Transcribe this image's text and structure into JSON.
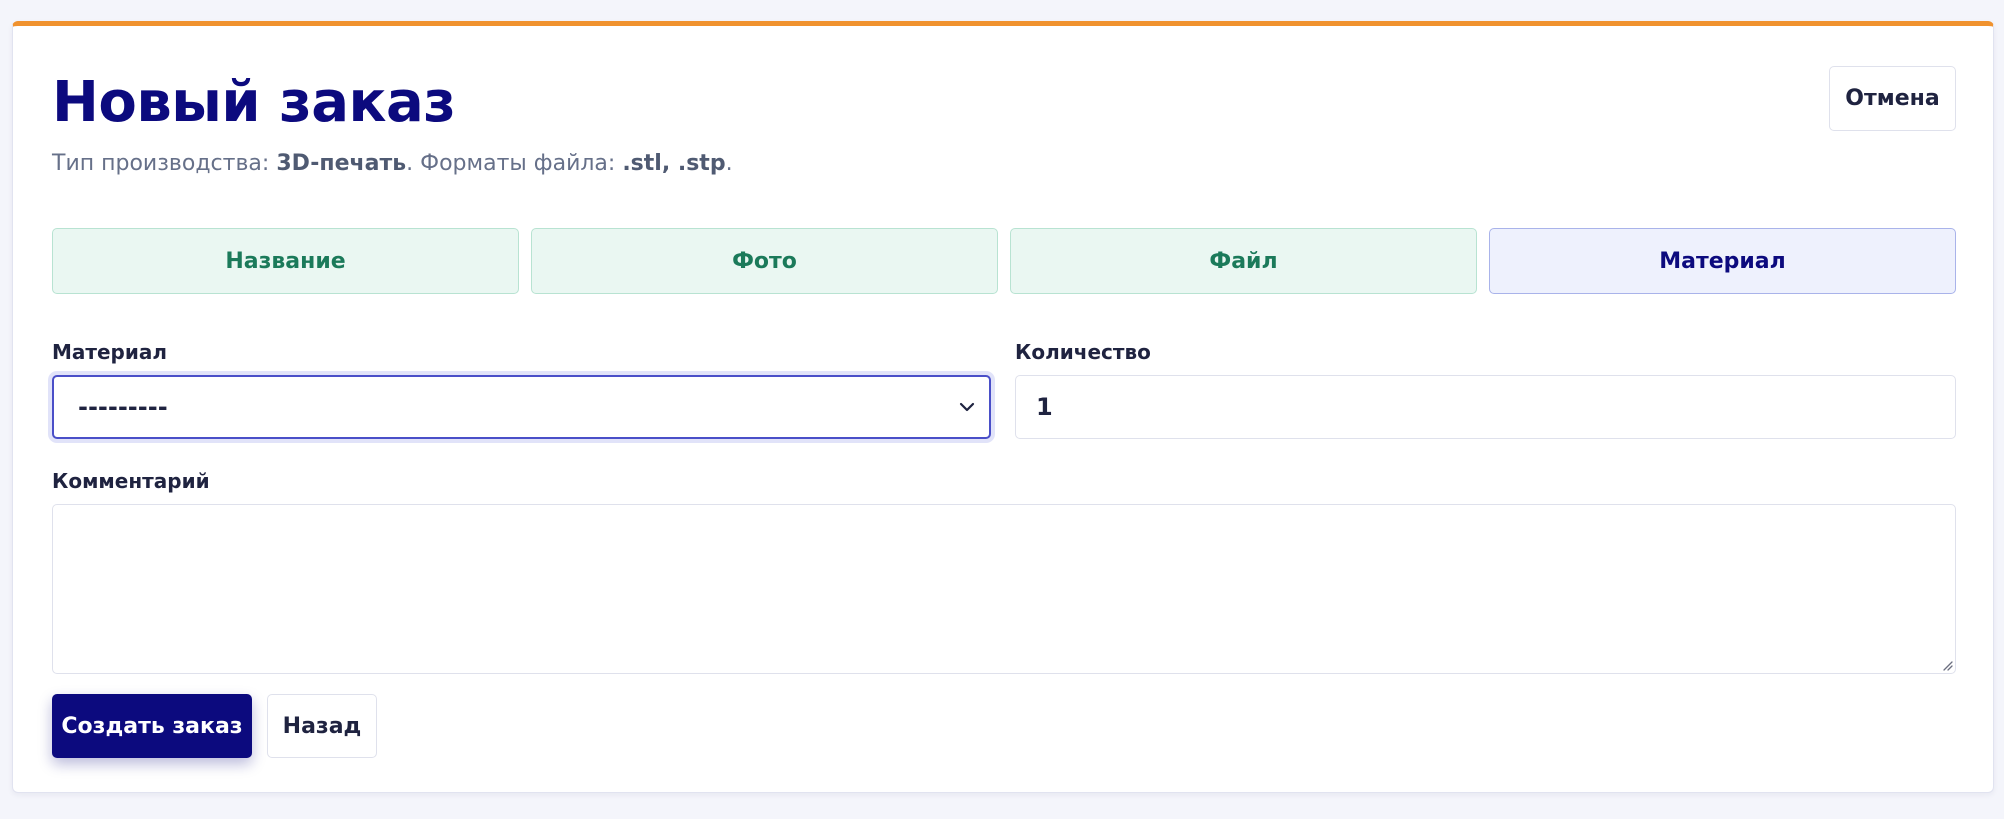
{
  "page": {
    "title": "Новый заказ",
    "subtitle": {
      "prefix": "Тип производства: ",
      "production_type": "3D-печать",
      "middle": ". Форматы файла: ",
      "formats": ".stl, .stp",
      "suffix": "."
    }
  },
  "header": {
    "cancel_label": "Отмена"
  },
  "steps": [
    {
      "label": "Название",
      "state": "done"
    },
    {
      "label": "Фото",
      "state": "done"
    },
    {
      "label": "Файл",
      "state": "done"
    },
    {
      "label": "Материал",
      "state": "active"
    }
  ],
  "form": {
    "material": {
      "label": "Материал",
      "selected": "---------"
    },
    "quantity": {
      "label": "Количество",
      "value": "1"
    },
    "comment": {
      "label": "Комментарий",
      "value": ""
    }
  },
  "actions": {
    "submit_label": "Создать заказ",
    "back_label": "Назад"
  },
  "colors": {
    "accent_top": "#f0922e",
    "primary": "#0c0a7e",
    "step_done_bg": "#eaf7f2",
    "step_done_text": "#1b7a5a",
    "step_active_bg": "#eef1fd"
  },
  "icons": {
    "select_arrow": "chevron-down-icon",
    "textarea_resize": "resize-handle-icon"
  }
}
